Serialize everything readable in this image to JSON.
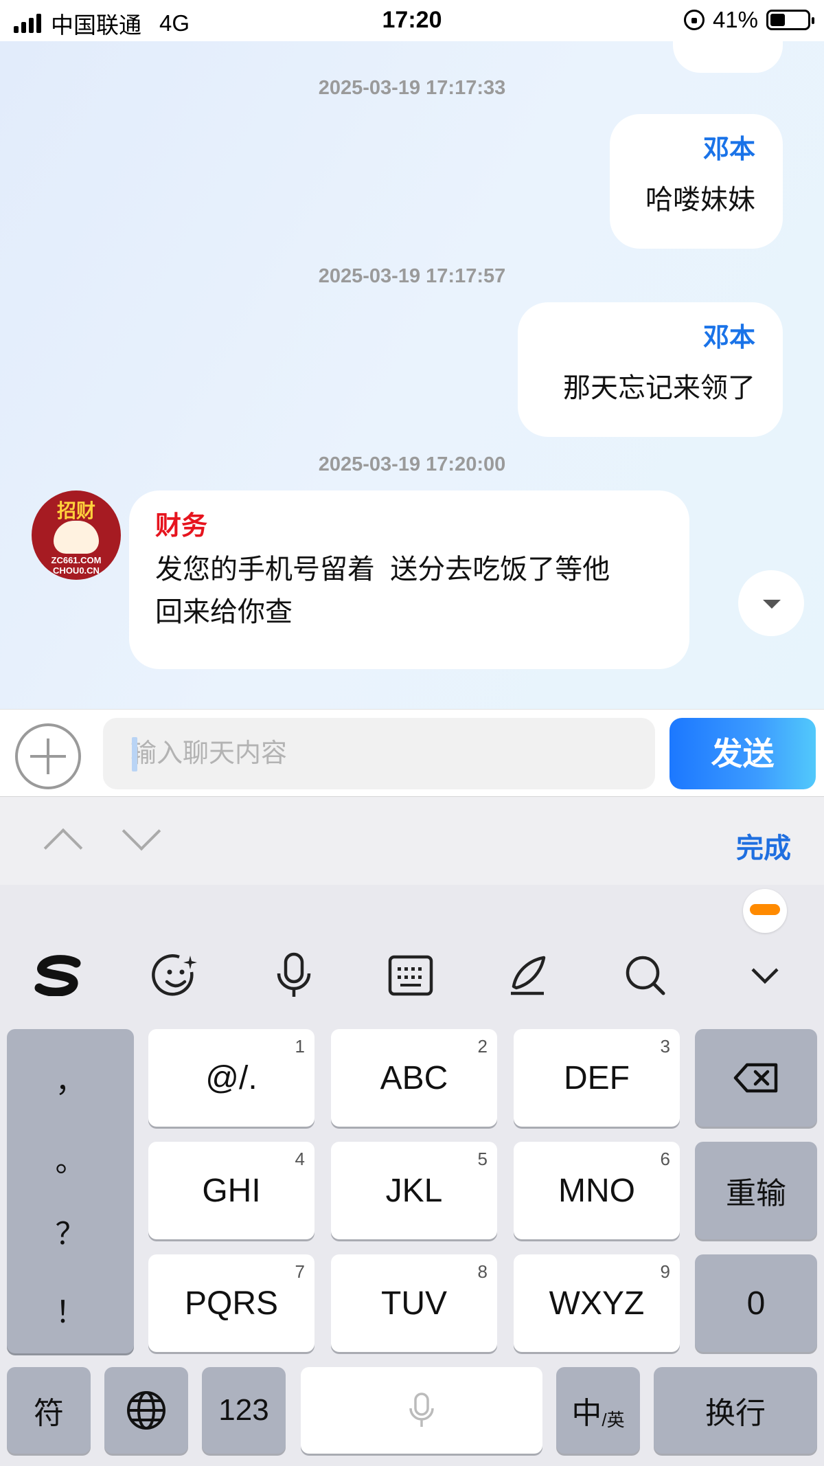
{
  "status_bar": {
    "carrier": "中国联通",
    "network": "4G",
    "time": "17:20",
    "battery": "41%",
    "battery_level": 0.41
  },
  "messages": [
    {
      "timestamp": "2025-03-19 17:17:33",
      "sender": "邓本",
      "text": "哈喽妹妹",
      "side": "right"
    },
    {
      "timestamp": "2025-03-19 17:17:57",
      "sender": "邓本",
      "text": "那天忘记来领了",
      "side": "right"
    },
    {
      "timestamp": "2025-03-19 17:20:00",
      "sender": "财务",
      "text_lines": [
        "发您的手机号留着  送分去吃饭了等他",
        "回来给你查"
      ],
      "side": "left",
      "avatar": {
        "title": "招财",
        "domain_lines": [
          "ZC661.COM",
          "CHOU0.CN"
        ]
      }
    }
  ],
  "input": {
    "placeholder": "输入聊天内容",
    "send_label": "发送"
  },
  "keyboard": {
    "done_label": "完成",
    "toolbar_icons": [
      "sogou-logo-icon",
      "emoji-icon",
      "microphone-icon",
      "keyboard-icon",
      "handwriting-pen-icon",
      "search-icon",
      "collapse-chevron-icon"
    ],
    "punctuation": [
      "，",
      "。",
      "？",
      "！"
    ],
    "keys": [
      {
        "label": "@/.",
        "num": "1"
      },
      {
        "label": "ABC",
        "num": "2"
      },
      {
        "label": "DEF",
        "num": "3"
      },
      {
        "label": "GHI",
        "num": "4"
      },
      {
        "label": "JKL",
        "num": "5"
      },
      {
        "label": "MNO",
        "num": "6"
      },
      {
        "label": "PQRS",
        "num": "7"
      },
      {
        "label": "TUV",
        "num": "8"
      },
      {
        "label": "WXYZ",
        "num": "9"
      }
    ],
    "reinput": "重输",
    "zero": "0",
    "symbol": "符",
    "num_switch": "123",
    "lang_main": "中",
    "lang_sub": "/英",
    "enter": "换行"
  }
}
